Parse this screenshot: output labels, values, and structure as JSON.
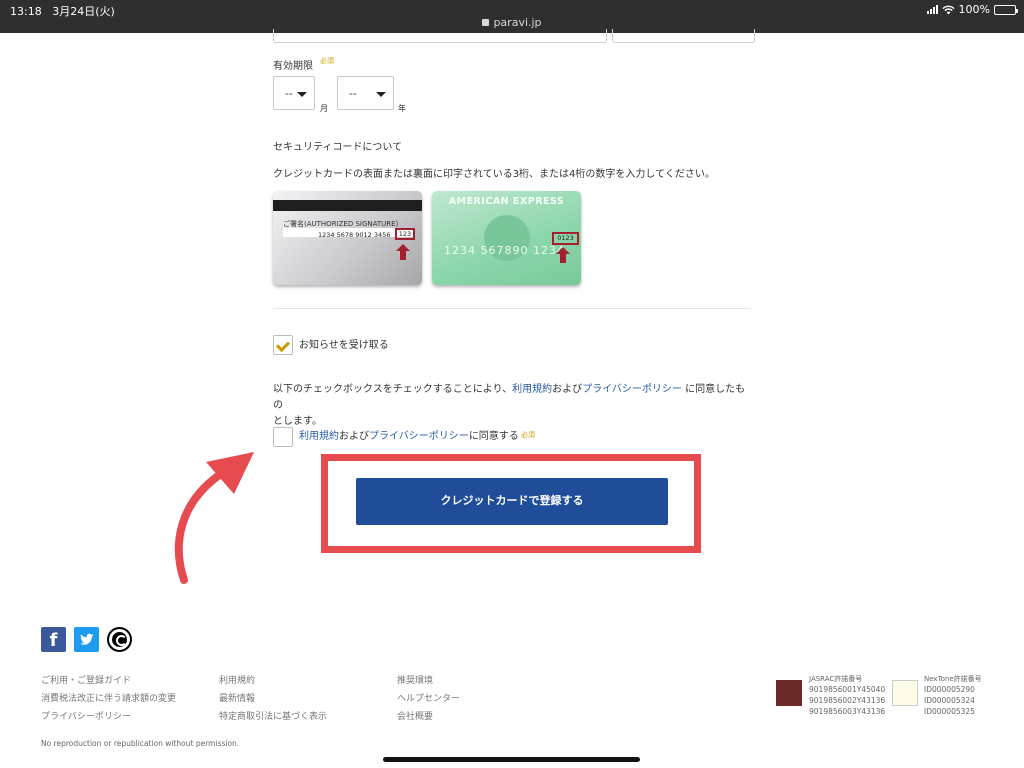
{
  "status_bar": {
    "time": "13:18",
    "date": "3月24日(火)",
    "url": "paravi.jp",
    "battery": "100%"
  },
  "expiry": {
    "label": "有効期限",
    "required": "必須",
    "month_value": "--",
    "month_unit": "月",
    "year_value": "--",
    "year_unit": "年"
  },
  "security": {
    "title": "セキュリティコードについて",
    "description": "クレジットカードの表面または裏面に印字されている3桁、または4桁の数字を入力してください。",
    "card_back": {
      "signature_label": "ご署名(AUTHORIZED SIGNATURE)",
      "number": "1234 5678 9012 3456",
      "code": "123"
    },
    "card_front": {
      "brand": "AMERICAN EXPRESS",
      "number": "1234  567890  1234",
      "code": "0123"
    }
  },
  "newsletter": {
    "label": "お知らせを受け取る",
    "checked": true
  },
  "consent": {
    "notice_pre": "以下のチェックボックスをチェックすることにより、",
    "notice_terms": "利用規約",
    "notice_and": "および",
    "notice_privacy": "プライバシーポリシー",
    "notice_post_line1": "に同意したもの",
    "notice_post_line2": "とします。",
    "checkbox_terms": "利用規約",
    "checkbox_and": "および",
    "checkbox_privacy": "プライバシーポリシー",
    "checkbox_suffix": "に同意する",
    "required": "必須",
    "checked": false
  },
  "submit_label": "クレジットカードで登録する",
  "footer": {
    "col1": [
      "ご利用・ご登録ガイド",
      "消費税法改正に伴う請求額の変更",
      "プライバシーポリシー"
    ],
    "col2": [
      "利用規約",
      "最新情報",
      "特定商取引法に基づく表示"
    ],
    "col3": [
      "推奨環境",
      "ヘルプセンター",
      "会社概要"
    ],
    "jasrac": {
      "label": "JASRAC許諾番号",
      "ids": [
        "9019856001Y45040",
        "9019856002Y43136",
        "9019856003Y43136"
      ]
    },
    "nextone": {
      "label": "NexTone許諾番号",
      "ids": [
        "ID000005290",
        "ID000005324",
        "ID000005325"
      ]
    },
    "copyright": "No reproduction or republication without permission."
  },
  "colors": {
    "accent_blue": "#1f4d99",
    "highlight_red": "#e54b4f",
    "required_gold": "#c9a100",
    "link_blue": "#2a5ca8"
  }
}
